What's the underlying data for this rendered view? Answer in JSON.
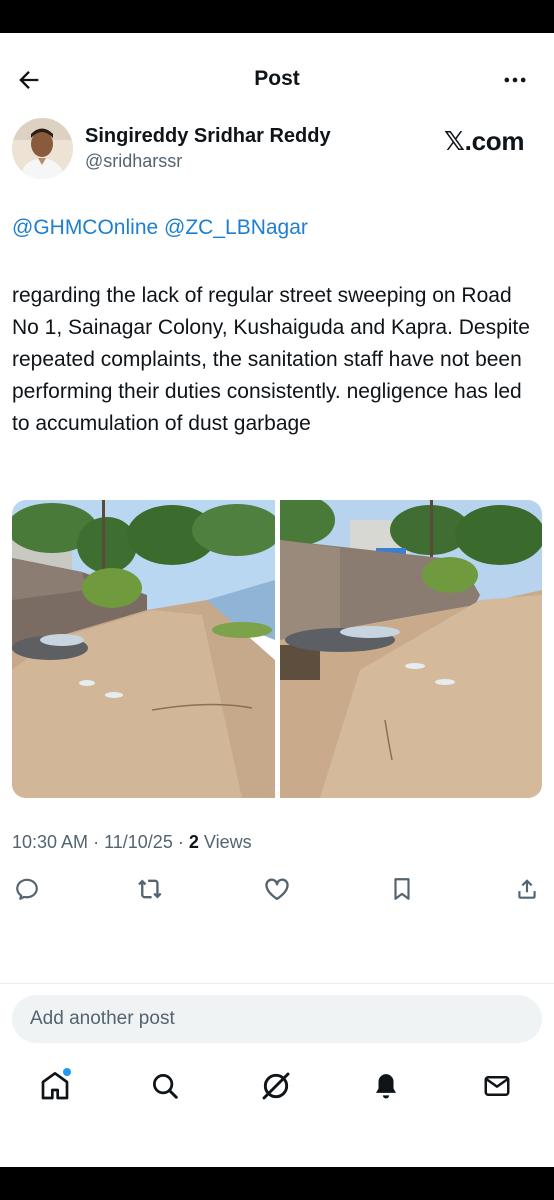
{
  "header": {
    "title": "Post"
  },
  "author": {
    "name": "Singireddy Sridhar Reddy",
    "handle": "@sridharssr"
  },
  "watermark": "𝕏.com",
  "post": {
    "mentions": [
      "@GHMCOnline",
      "@ZC_LBNagar"
    ],
    "text": "regarding the lack of regular street sweeping on Road No 1, Sainagar Colony, Kushaiguda and Kapra. Despite repeated complaints, the sanitation staff have not been performing their duties consistently. negligence has led to accumulation of dust garbage"
  },
  "meta": {
    "time": "10:30 AM",
    "date": "11/10/25",
    "separator": "·",
    "views_count": "2",
    "views_label": "Views"
  },
  "reply": {
    "placeholder": "Add another post"
  },
  "colors": {
    "link": "#1d7fd0",
    "secondary_text": "#536471",
    "notification_dot": "#1d9bf0"
  }
}
